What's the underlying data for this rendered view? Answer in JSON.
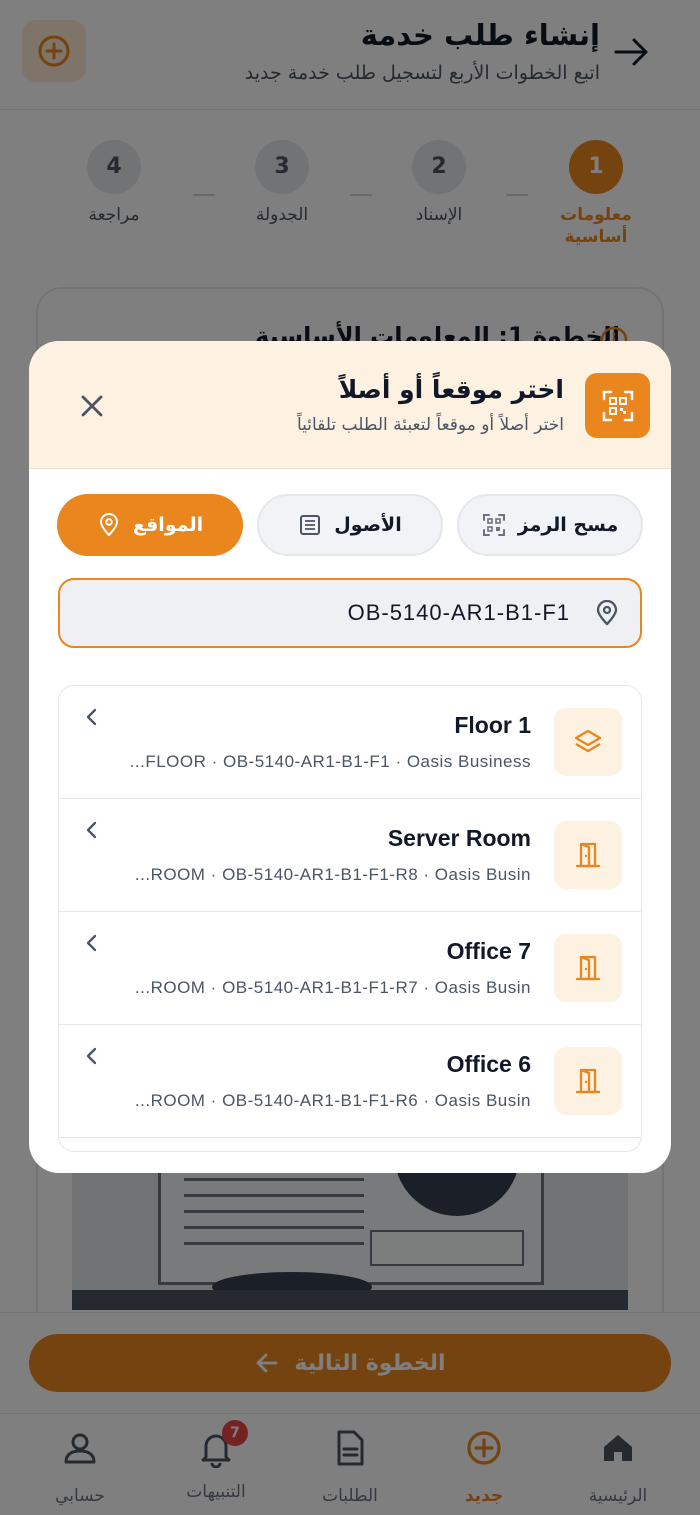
{
  "header": {
    "title": "إنشاء طلب خدمة",
    "subtitle": "اتبع الخطوات الأربع لتسجيل طلب خدمة جديد"
  },
  "stepper": {
    "steps": [
      {
        "number": "1",
        "label": "معلومات أساسية",
        "active": true
      },
      {
        "number": "2",
        "label": "الإسناد",
        "active": false
      },
      {
        "number": "3",
        "label": "الجدولة",
        "active": false
      },
      {
        "number": "4",
        "label": "مراجعة",
        "active": false
      }
    ]
  },
  "card": {
    "title": "الخطوة 1: المعلومات الأساسية"
  },
  "footer": {
    "next_label": "الخطوة التالية"
  },
  "bottom_nav": {
    "items": [
      {
        "label": "الرئيسية",
        "icon": "home-icon"
      },
      {
        "label": "جديد",
        "icon": "plus-circle-icon",
        "active": true
      },
      {
        "label": "الطلبات",
        "icon": "document-icon"
      },
      {
        "label": "التنبيهات",
        "icon": "bell-icon",
        "badge": "7"
      },
      {
        "label": "حسابي",
        "icon": "user-icon"
      }
    ]
  },
  "modal": {
    "title": "اختر موقعاً أو أصلاً",
    "subtitle": "اختر أصلاً أو موقعاً لتعبئة الطلب تلقائياً",
    "filters": [
      {
        "label": "مسح الرمز",
        "icon": "qr-scan-icon",
        "active": false
      },
      {
        "label": "الأصول",
        "icon": "list-icon",
        "active": false
      },
      {
        "label": "المواقع",
        "icon": "location-pin-icon",
        "active": true
      }
    ],
    "search": {
      "value": "OB-5140-AR1-B1-F1"
    },
    "results": [
      {
        "name": "Floor 1",
        "meta": "...FLOOR · OB-5140-AR1-B1-F1 · Oasis Business",
        "icon": "layers-icon"
      },
      {
        "name": "Server Room",
        "meta": "...ROOM · OB-5140-AR1-B1-F1-R8 · Oasis Busin",
        "icon": "door-icon"
      },
      {
        "name": "Office 7",
        "meta": "...ROOM · OB-5140-AR1-B1-F1-R7 · Oasis Busin",
        "icon": "door-icon"
      },
      {
        "name": "Office 6",
        "meta": "...ROOM · OB-5140-AR1-B1-F1-R6 · Oasis Busin",
        "icon": "door-icon"
      }
    ]
  },
  "colors": {
    "accent": "#e9861e",
    "accent_soft": "#fdf1e2",
    "badge": "#ef4444"
  }
}
